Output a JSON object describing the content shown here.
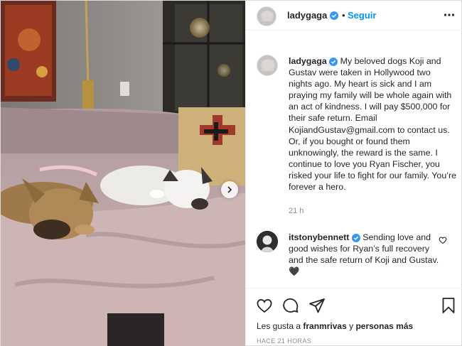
{
  "post": {
    "username": "ladygaga",
    "separator": "•",
    "follow_label": "Seguir",
    "caption_user": "ladygaga",
    "caption_text": "My beloved dogs Koji and Gustav were taken in Hollywood two nights ago. My heart is sick and I am praying my family will be whole again with an act of kindness. I will pay $500,000 for their safe return. Email KojiandGustav@gmail.com to contact us. Or, if you bought or found them unknowingly, the reward is the same. I continue to love you Ryan Fischer, you risked your life to fight for our family. You’re forever a hero.",
    "time_ago": "21 h"
  },
  "comment": {
    "username": "itstonybennett",
    "text": "Sending love and good wishes for Ryan’s full recovery and the safe return of Koji and Gustav.🖤"
  },
  "likes": {
    "prefix": "Les gusta a",
    "user": "franmrivas",
    "connector": "y",
    "others": "personas más"
  },
  "posted_label": "HACE 21 HORAS",
  "icons": {
    "verified": "verified-badge-icon",
    "more": "more-options-icon",
    "like": "heart-icon",
    "comment": "comment-icon",
    "share": "paper-plane-icon",
    "save": "bookmark-icon",
    "next": "chevron-right-icon"
  },
  "colors": {
    "link_blue": "#0095f6",
    "verified_blue": "#3897f0",
    "muted_text": "#8e8e8e"
  }
}
